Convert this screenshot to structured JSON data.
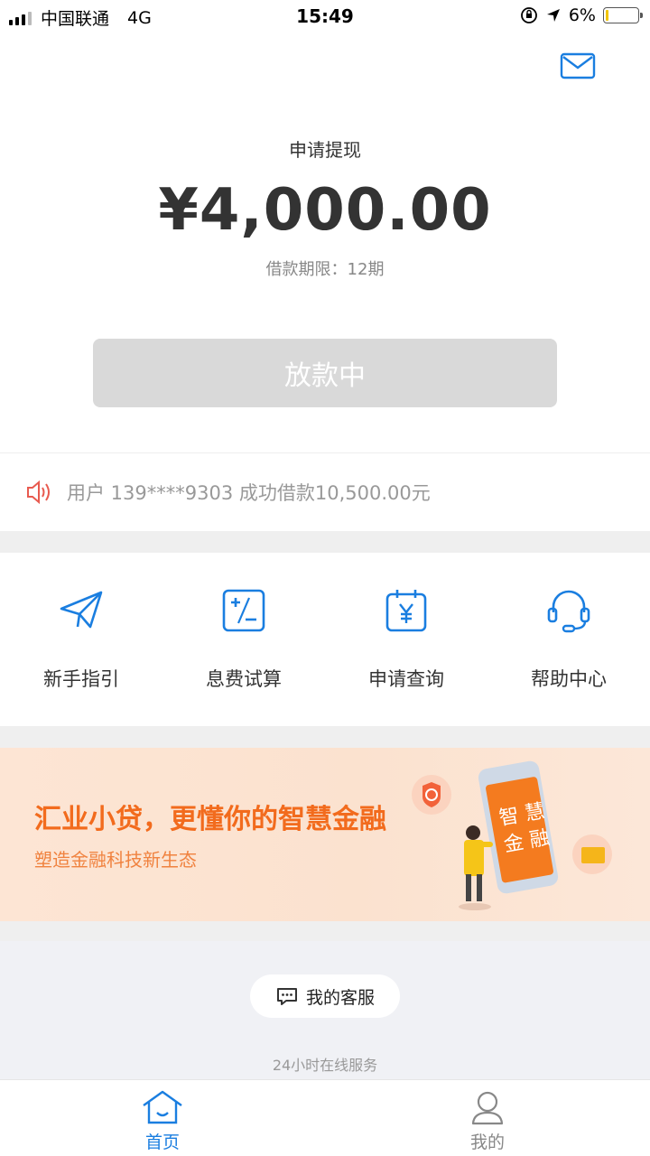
{
  "status_bar": {
    "carrier": "中国联通",
    "network": "4G",
    "time": "15:49",
    "battery": "6%"
  },
  "header": {
    "mail_icon": "mail-icon"
  },
  "loan": {
    "title": "申请提现",
    "amount": "¥4,000.00",
    "term_label": "借款期限：12期",
    "status_button": "放款中"
  },
  "notice": {
    "text": "用户 139****9303 成功借款10,500.00元",
    "icon": "speaker-icon"
  },
  "menu": {
    "items": [
      {
        "label": "新手指引",
        "icon": "paper-plane-icon"
      },
      {
        "label": "息费试算",
        "icon": "calculator-icon"
      },
      {
        "label": "申请查询",
        "icon": "calendar-yen-icon"
      },
      {
        "label": "帮助中心",
        "icon": "headset-icon"
      }
    ]
  },
  "banner": {
    "title": "汇业小贷，更懂你的智慧金融",
    "subtitle": "塑造金融科技新生态",
    "phone_text": "智慧金融"
  },
  "support": {
    "button_label": "我的客服",
    "subtitle": "24小时在线服务"
  },
  "tabbar": {
    "tabs": [
      {
        "label": "首页",
        "icon": "home-icon",
        "active": true
      },
      {
        "label": "我的",
        "icon": "user-icon",
        "active": false
      }
    ]
  },
  "colors": {
    "accent": "#1a7ee0",
    "banner_orange": "#f26b1d",
    "notice_red": "#e85a4f",
    "disabled_button": "#d9d9d9"
  }
}
